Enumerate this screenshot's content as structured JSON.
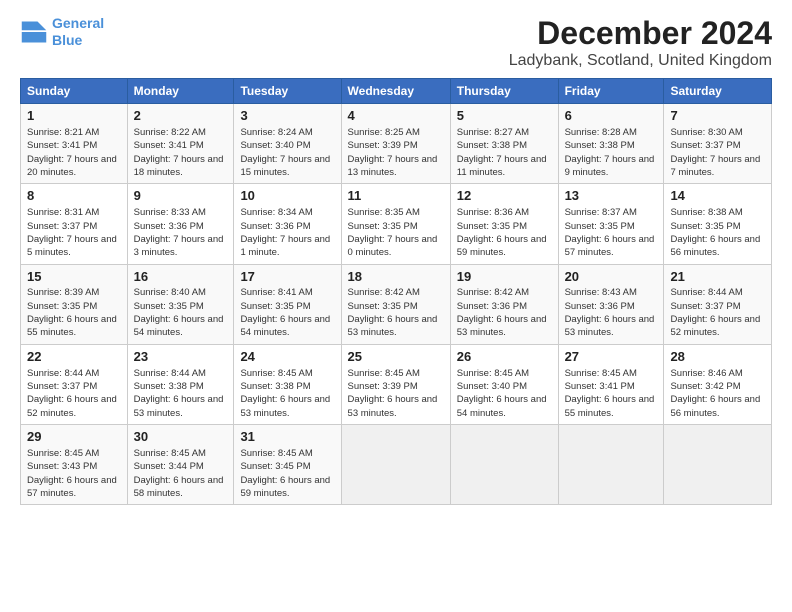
{
  "logo": {
    "line1": "General",
    "line2": "Blue"
  },
  "title": "December 2024",
  "subtitle": "Ladybank, Scotland, United Kingdom",
  "days_of_week": [
    "Sunday",
    "Monday",
    "Tuesday",
    "Wednesday",
    "Thursday",
    "Friday",
    "Saturday"
  ],
  "weeks": [
    [
      {
        "day": "1",
        "rise": "8:21 AM",
        "set": "3:41 PM",
        "hours": "7 hours and 20 minutes."
      },
      {
        "day": "2",
        "rise": "8:22 AM",
        "set": "3:41 PM",
        "hours": "7 hours and 18 minutes."
      },
      {
        "day": "3",
        "rise": "8:24 AM",
        "set": "3:40 PM",
        "hours": "7 hours and 15 minutes."
      },
      {
        "day": "4",
        "rise": "8:25 AM",
        "set": "3:39 PM",
        "hours": "7 hours and 13 minutes."
      },
      {
        "day": "5",
        "rise": "8:27 AM",
        "set": "3:38 PM",
        "hours": "7 hours and 11 minutes."
      },
      {
        "day": "6",
        "rise": "8:28 AM",
        "set": "3:38 PM",
        "hours": "7 hours and 9 minutes."
      },
      {
        "day": "7",
        "rise": "8:30 AM",
        "set": "3:37 PM",
        "hours": "7 hours and 7 minutes."
      }
    ],
    [
      {
        "day": "8",
        "rise": "8:31 AM",
        "set": "3:37 PM",
        "hours": "7 hours and 5 minutes."
      },
      {
        "day": "9",
        "rise": "8:33 AM",
        "set": "3:36 PM",
        "hours": "7 hours and 3 minutes."
      },
      {
        "day": "10",
        "rise": "8:34 AM",
        "set": "3:36 PM",
        "hours": "7 hours and 1 minute."
      },
      {
        "day": "11",
        "rise": "8:35 AM",
        "set": "3:35 PM",
        "hours": "7 hours and 0 minutes."
      },
      {
        "day": "12",
        "rise": "8:36 AM",
        "set": "3:35 PM",
        "hours": "6 hours and 59 minutes."
      },
      {
        "day": "13",
        "rise": "8:37 AM",
        "set": "3:35 PM",
        "hours": "6 hours and 57 minutes."
      },
      {
        "day": "14",
        "rise": "8:38 AM",
        "set": "3:35 PM",
        "hours": "6 hours and 56 minutes."
      }
    ],
    [
      {
        "day": "15",
        "rise": "8:39 AM",
        "set": "3:35 PM",
        "hours": "6 hours and 55 minutes."
      },
      {
        "day": "16",
        "rise": "8:40 AM",
        "set": "3:35 PM",
        "hours": "6 hours and 54 minutes."
      },
      {
        "day": "17",
        "rise": "8:41 AM",
        "set": "3:35 PM",
        "hours": "6 hours and 54 minutes."
      },
      {
        "day": "18",
        "rise": "8:42 AM",
        "set": "3:35 PM",
        "hours": "6 hours and 53 minutes."
      },
      {
        "day": "19",
        "rise": "8:42 AM",
        "set": "3:36 PM",
        "hours": "6 hours and 53 minutes."
      },
      {
        "day": "20",
        "rise": "8:43 AM",
        "set": "3:36 PM",
        "hours": "6 hours and 53 minutes."
      },
      {
        "day": "21",
        "rise": "8:44 AM",
        "set": "3:37 PM",
        "hours": "6 hours and 52 minutes."
      }
    ],
    [
      {
        "day": "22",
        "rise": "8:44 AM",
        "set": "3:37 PM",
        "hours": "6 hours and 52 minutes."
      },
      {
        "day": "23",
        "rise": "8:44 AM",
        "set": "3:38 PM",
        "hours": "6 hours and 53 minutes."
      },
      {
        "day": "24",
        "rise": "8:45 AM",
        "set": "3:38 PM",
        "hours": "6 hours and 53 minutes."
      },
      {
        "day": "25",
        "rise": "8:45 AM",
        "set": "3:39 PM",
        "hours": "6 hours and 53 minutes."
      },
      {
        "day": "26",
        "rise": "8:45 AM",
        "set": "3:40 PM",
        "hours": "6 hours and 54 minutes."
      },
      {
        "day": "27",
        "rise": "8:45 AM",
        "set": "3:41 PM",
        "hours": "6 hours and 55 minutes."
      },
      {
        "day": "28",
        "rise": "8:46 AM",
        "set": "3:42 PM",
        "hours": "6 hours and 56 minutes."
      }
    ],
    [
      {
        "day": "29",
        "rise": "8:45 AM",
        "set": "3:43 PM",
        "hours": "6 hours and 57 minutes."
      },
      {
        "day": "30",
        "rise": "8:45 AM",
        "set": "3:44 PM",
        "hours": "6 hours and 58 minutes."
      },
      {
        "day": "31",
        "rise": "8:45 AM",
        "set": "3:45 PM",
        "hours": "6 hours and 59 minutes."
      },
      null,
      null,
      null,
      null
    ]
  ],
  "labels": {
    "sunrise": "Sunrise:",
    "sunset": "Sunset:",
    "daylight": "Daylight:"
  }
}
